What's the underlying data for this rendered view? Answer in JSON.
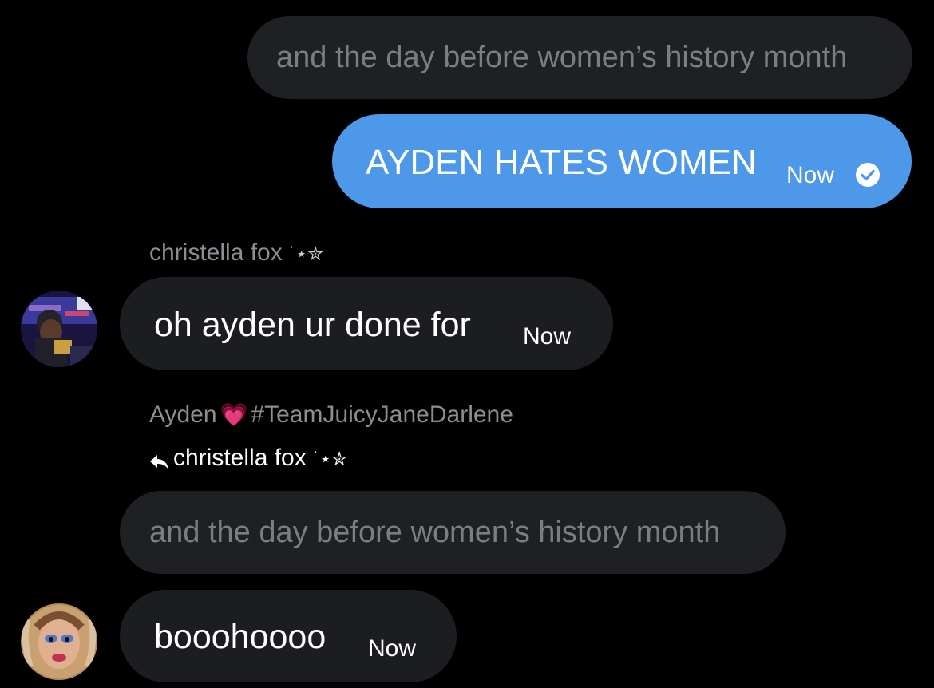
{
  "messages": {
    "quoted_top": {
      "text": "and the day before women’s history month"
    },
    "outgoing_1": {
      "text": "AYDEN HATES WOMEN",
      "time": "Now",
      "status_icon": "check-circle-icon"
    },
    "incoming_1": {
      "sender": "christella fox",
      "sender_decoration": "˙⋆✮",
      "text": "oh ayden ur done for",
      "time": "Now"
    },
    "incoming_2": {
      "sender": "Ayden",
      "sender_emoji": "💗",
      "sender_tag": "#TeamJuicyJaneDarlene",
      "reply_to_icon": "reply-arrow-icon",
      "reply_to": "christella fox",
      "reply_to_decoration": "˙⋆✮",
      "quoted_text": "and the day before women’s history month",
      "text": "booohoooo",
      "time": "Now"
    }
  },
  "colors": {
    "background": "#000000",
    "outgoing_bubble": "#4d98e8",
    "incoming_bubble": "#1c1d20",
    "quoted_bubble": "#1e2023",
    "secondary_text": "#8b8e93"
  }
}
